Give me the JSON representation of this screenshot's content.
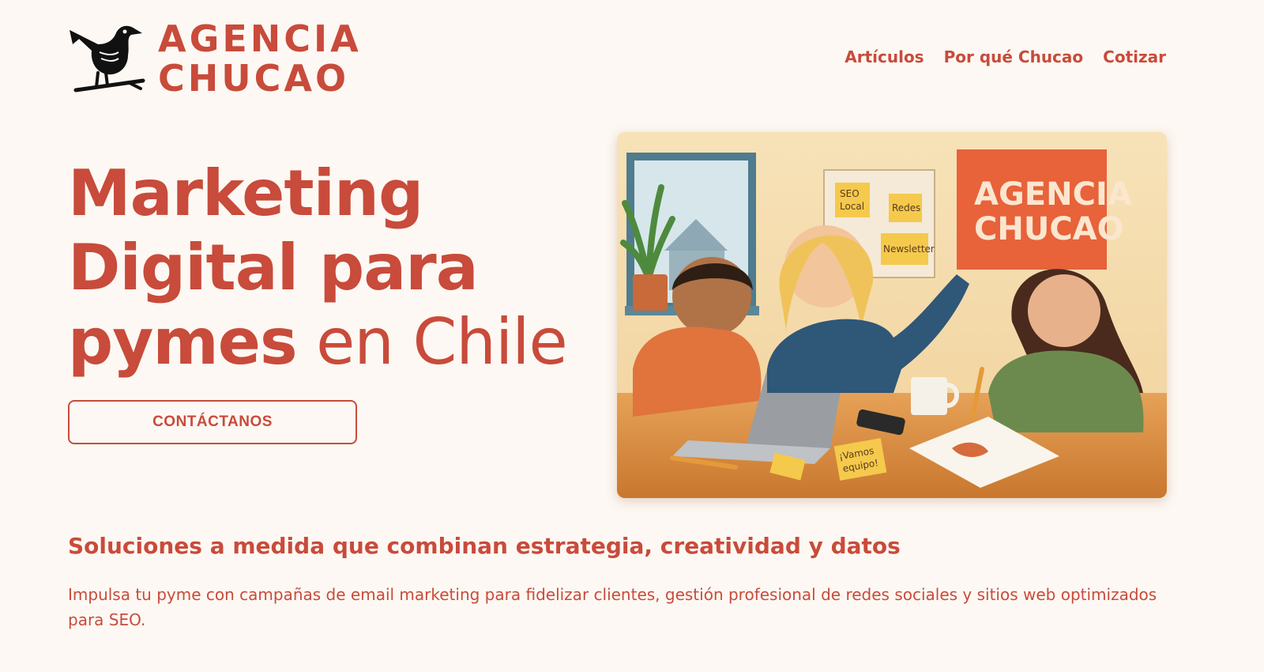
{
  "brand": {
    "line1": "AGENCIA",
    "line2": "CHUCAO",
    "icon": "bird-logo-icon"
  },
  "nav": {
    "items": [
      {
        "label": "Artículos"
      },
      {
        "label": "Por qué Chucao"
      },
      {
        "label": "Cotizar"
      }
    ]
  },
  "hero": {
    "headline_line1": "Marketing",
    "headline_line2": "Digital para",
    "headline_bold": "pymes",
    "headline_light": " en Chile",
    "cta_label": "CONTÁCTANOS",
    "image": {
      "sign_line1": "AGENCIA",
      "sign_line2": "CHUCAO",
      "note_seo_1": "SEO",
      "note_seo_2": "Local",
      "note_redes": "Redes",
      "note_newsletter": "Newsletter",
      "note_table_1": "¡Vamos",
      "note_table_2": "equipo!"
    }
  },
  "section": {
    "subtitle": "Soluciones a medida que combinan estrategia, creatividad y datos",
    "description": "Impulsa tu pyme con campañas de email marketing para fidelizar clientes, gestión profesional de redes sociales y sitios web optimizados para SEO."
  },
  "colors": {
    "accent": "#c84b3b",
    "background": "#fdf8f3",
    "sign": "#e8623a"
  }
}
